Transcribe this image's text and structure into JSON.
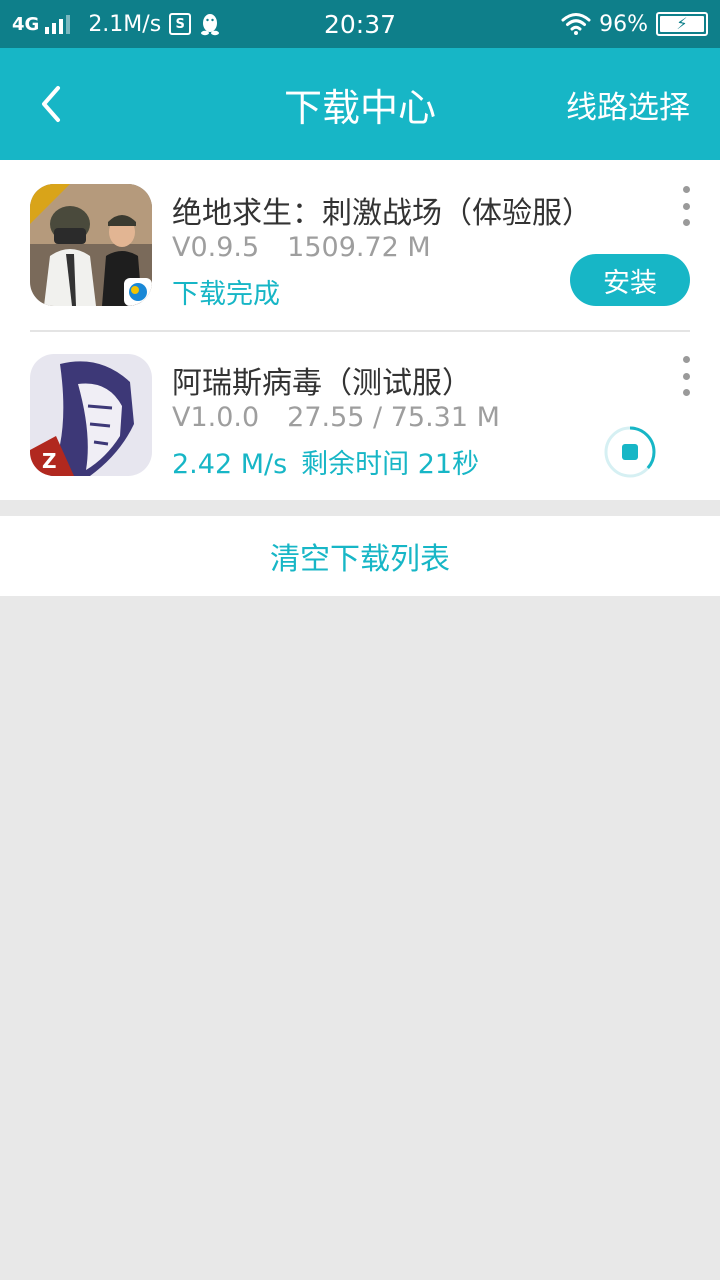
{
  "status_bar": {
    "network": "4G",
    "speed": "2.1M/s",
    "app_badge": "S",
    "time": "20:37",
    "battery": "96%"
  },
  "header": {
    "title": "下载中心",
    "route_select": "线路选择"
  },
  "downloads": [
    {
      "name": "绝地求生：刺激战场（体验服）",
      "version": "V0.9.5",
      "size": "1509.72 M",
      "status": "下载完成",
      "action": "安装",
      "icon": "pubg-app-icon"
    },
    {
      "name": "阿瑞斯病毒（测试服）",
      "version": "V1.0.0",
      "size": "27.55 / 75.31 M",
      "speed": "2.42 M/s",
      "remaining": "剩余时间 21秒",
      "progress": 0.366,
      "icon": "ares-virus-app-icon"
    }
  ],
  "clear_label": "清空下载列表",
  "colors": {
    "accent": "#17b6c6",
    "status_bar": "#0e7f8a",
    "background": "#e8e8e8"
  }
}
